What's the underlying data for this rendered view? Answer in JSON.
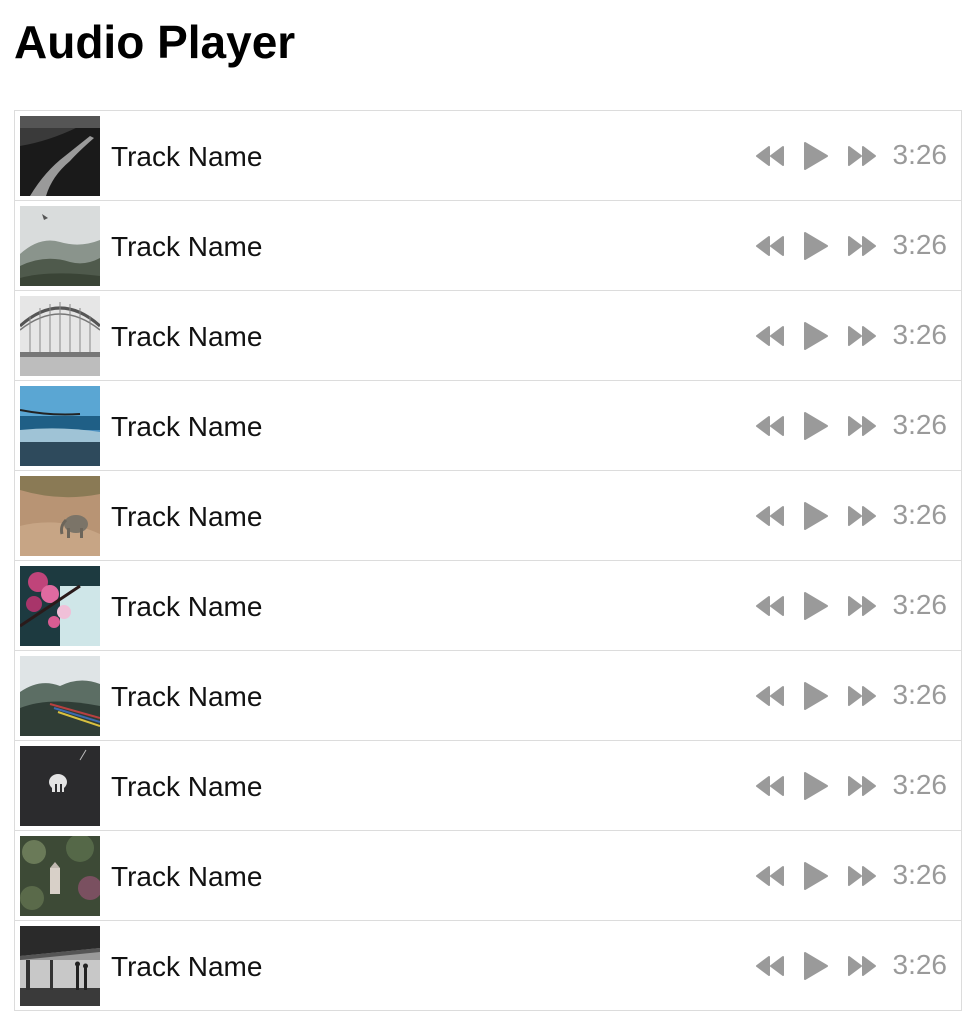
{
  "page": {
    "title": "Audio Player"
  },
  "colors": {
    "control": "#9a9a9a",
    "border": "#dcdcdc"
  },
  "icons": {
    "rewind": "rewind-icon",
    "play": "play-icon",
    "forward": "fast-forward-icon"
  },
  "tracks": [
    {
      "name": "Track Name",
      "duration": "3:26",
      "art": "dark-road"
    },
    {
      "name": "Track Name",
      "duration": "3:26",
      "art": "misty-hill"
    },
    {
      "name": "Track Name",
      "duration": "3:26",
      "art": "bridge-arch"
    },
    {
      "name": "Track Name",
      "duration": "3:26",
      "art": "beach-sea"
    },
    {
      "name": "Track Name",
      "duration": "3:26",
      "art": "elephant-dirt"
    },
    {
      "name": "Track Name",
      "duration": "3:26",
      "art": "pink-blossom"
    },
    {
      "name": "Track Name",
      "duration": "3:26",
      "art": "mountain-flags"
    },
    {
      "name": "Track Name",
      "duration": "3:26",
      "art": "dark-skull"
    },
    {
      "name": "Track Name",
      "duration": "3:26",
      "art": "forest-figure"
    },
    {
      "name": "Track Name",
      "duration": "3:26",
      "art": "station-silhouettes"
    }
  ]
}
